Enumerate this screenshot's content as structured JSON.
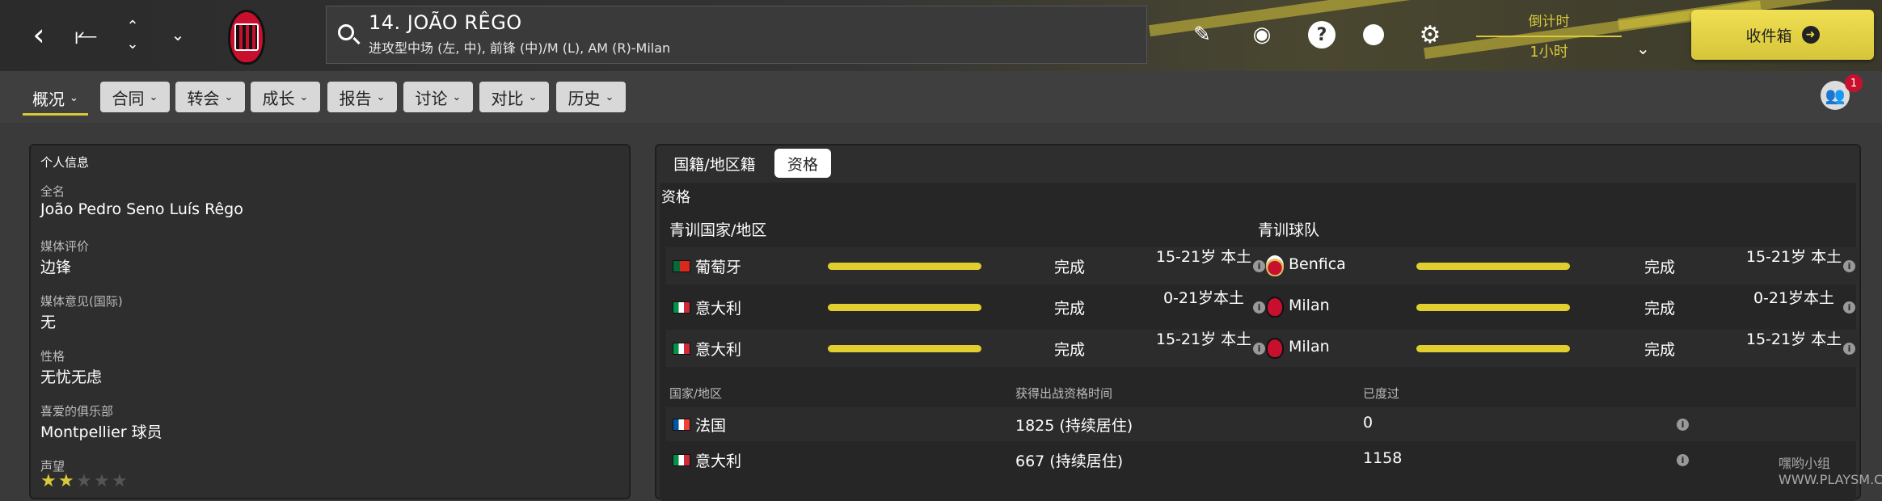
{
  "player": {
    "title": "14. JOÃO RÊGO",
    "positions": "进攻型中场 (左, 中), 前锋 (中)/M (L), AM (R)-Milan"
  },
  "timer": {
    "label": "倒计时",
    "value": "1小时"
  },
  "inbox": {
    "label": "收件箱"
  },
  "badge_count": "1",
  "main_tab": {
    "label": "概况"
  },
  "menu": [
    "合同",
    "转会",
    "成长",
    "报告",
    "讨论",
    "对比",
    "历史"
  ],
  "personal": {
    "section_title": "个人信息",
    "fields": [
      {
        "label": "全名",
        "value": "João Pedro Seno Luís Rêgo"
      },
      {
        "label": "媒体评价",
        "value": "边锋"
      },
      {
        "label": "媒体意见(国际)",
        "value": "无"
      },
      {
        "label": "性格",
        "value": "无忧无虑"
      },
      {
        "label": "喜爱的俱乐部",
        "value": "Montpellier 球员"
      },
      {
        "label": "声望",
        "value": ""
      }
    ],
    "reputation_stars": 2,
    "reputation_max": 5
  },
  "right_tabs": [
    "国籍/地区籍",
    "资格"
  ],
  "eligibility": {
    "title": "资格",
    "nation_header": "青训国家/地区",
    "club_header": "青训球队",
    "rows": [
      {
        "nation": "葡萄牙",
        "nation_flag": "portugal-flag",
        "nation_progress": 1.0,
        "nation_status": "完成",
        "nation_age": "15-21岁 本土",
        "club": "Benfica",
        "club_icon": "benfica-crest",
        "club_progress": 1.0,
        "club_status": "完成",
        "club_age": "15-21岁 本土"
      },
      {
        "nation": "意大利",
        "nation_flag": "italy-flag",
        "nation_progress": 1.0,
        "nation_status": "完成",
        "nation_age": "0-21岁本土",
        "club": "Milan",
        "club_icon": "milan-crest",
        "club_progress": 1.0,
        "club_status": "完成",
        "club_age": "0-21岁本土"
      },
      {
        "nation": "意大利",
        "nation_flag": "italy-flag",
        "nation_progress": 1.0,
        "nation_status": "完成",
        "nation_age": "15-21岁 本土",
        "club": "Milan",
        "club_icon": "milan-crest",
        "club_progress": 1.0,
        "club_status": "完成",
        "club_age": "15-21岁 本土"
      }
    ],
    "residency_headers": [
      "国家/地区",
      "获得出战资格时间",
      "已度过"
    ],
    "residency": [
      {
        "country": "法国",
        "flag": "france-flag",
        "time": "1825 (持续居住)",
        "spent": "0"
      },
      {
        "country": "意大利",
        "flag": "italy-flag",
        "time": "667 (持续居住)",
        "spent": "1158"
      }
    ]
  },
  "watermark": "嘿哟小组 WWW.PLAYSM.CC",
  "colors": {
    "accent": "#d9c93a",
    "milan_red": "#c8102e",
    "inbox_yellow": "#e9d84a"
  }
}
